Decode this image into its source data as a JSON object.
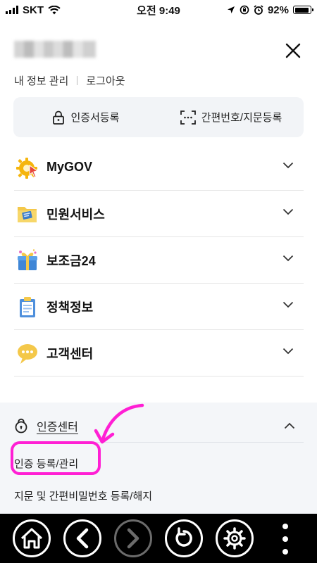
{
  "status_bar": {
    "carrier": "SKT",
    "time": "오전 9:49",
    "battery": "92%",
    "battery_level": 0.92
  },
  "header": {
    "close_icon": "close-icon",
    "account_links": [
      {
        "label": "내 정보 관리"
      },
      {
        "label": "로그아웃"
      }
    ]
  },
  "cert_bar": {
    "register_cert": {
      "label": "인증서등록",
      "icon": "lock-icon"
    },
    "register_pin": {
      "label": "간편번호/지문등록",
      "icon": "scan-icon"
    }
  },
  "menu": {
    "items": [
      {
        "label": "MyGOV",
        "icon": "mygov-icon"
      },
      {
        "label": "민원서비스",
        "icon": "folder-icon"
      },
      {
        "label": "보조금24",
        "icon": "gift-icon"
      },
      {
        "label": "정책정보",
        "icon": "clipboard-icon"
      },
      {
        "label": "고객센터",
        "icon": "chat-bubble-icon"
      }
    ]
  },
  "auth_center": {
    "label": "인증센터",
    "sub_items": [
      {
        "label": "인증 등록/관리"
      },
      {
        "label": "지문 및 간편비밀번호 등록/해지"
      }
    ]
  },
  "annotation": {
    "color": "#ff1fd4"
  },
  "bottom_nav": {
    "items": [
      "home-icon",
      "back-icon",
      "forward-icon",
      "refresh-icon",
      "settings-icon",
      "more-icon"
    ]
  }
}
